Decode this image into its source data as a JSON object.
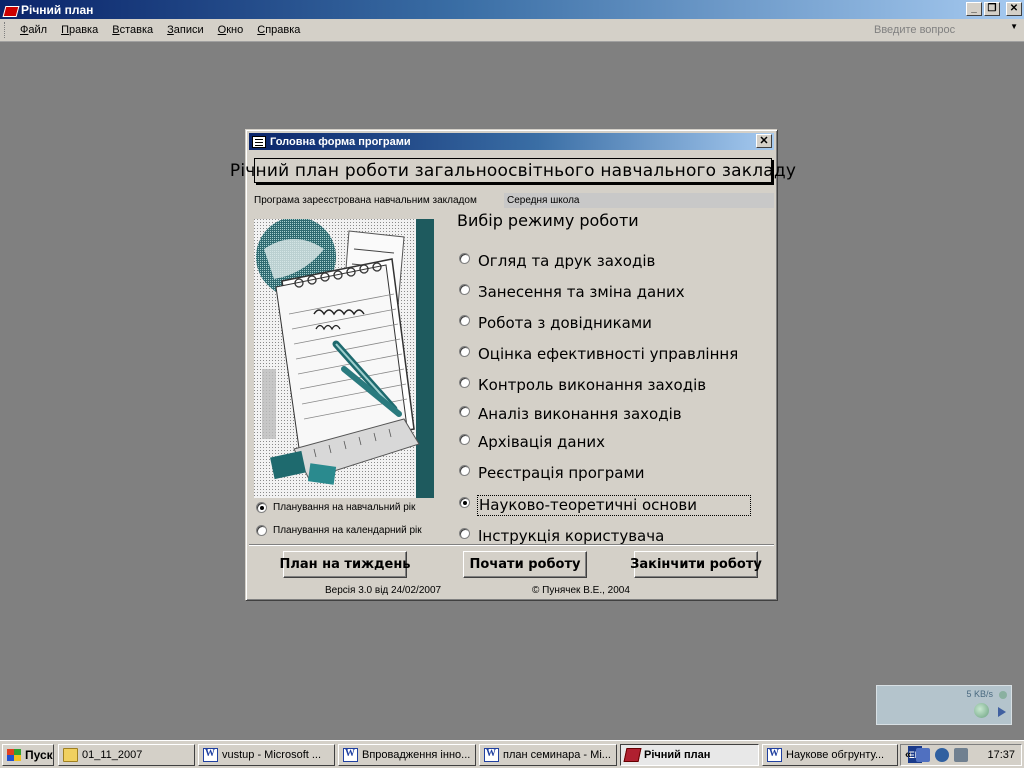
{
  "app": {
    "title": "Річний план",
    "menu": [
      "Файл",
      "Правка",
      "Вставка",
      "Записи",
      "Окно",
      "Справка"
    ],
    "help_placeholder": "Введите вопрос"
  },
  "form": {
    "title": "Головна форма програми",
    "heading": "Річний план роботи загальноосвітнього навчального закладу",
    "registered_label": "Програма зареєстрована навчальним закладом",
    "registered_value": "Середня школа",
    "mode_title": "Вибір режиму роботи",
    "modes": [
      {
        "label": "Огляд та друк заходів",
        "selected": false
      },
      {
        "label": "Занесення та зміна даних",
        "selected": false
      },
      {
        "label": "Робота з довідниками",
        "selected": false
      },
      {
        "label": "Оцінка ефективності управління",
        "selected": false
      },
      {
        "label": "Контроль виконання заходів",
        "selected": false
      },
      {
        "label": "Аналіз виконання заходів",
        "selected": false
      },
      {
        "label": "Архівація даних",
        "selected": false
      },
      {
        "label": "Реєстрація програми",
        "selected": false
      },
      {
        "label": "Науково-теоретичні основи",
        "selected": true
      },
      {
        "label": "Інструкція користувача",
        "selected": false
      }
    ],
    "planning": [
      {
        "label": "Планування на навчальний рік",
        "selected": true
      },
      {
        "label": "Планування на календарний рік",
        "selected": false
      }
    ],
    "buttons": {
      "week_plan": "План на тиждень",
      "start": "Почати  роботу",
      "finish": "Закінчити роботу"
    },
    "version": "Версія 3.0  від 24/02/2007",
    "copyright": "© Пунячек В.Е., 2004"
  },
  "net_widget": {
    "speed": "5 KB/s"
  },
  "taskbar": {
    "start": "Пуск",
    "tasks": [
      {
        "label": "01_11_2007",
        "icon": "folder-icon",
        "active": false
      },
      {
        "label": "vustup - Microsoft ...",
        "icon": "word-icon",
        "active": false
      },
      {
        "label": "Впровадження інно...",
        "icon": "word-icon",
        "active": false
      },
      {
        "label": "план семинара - Mi...",
        "icon": "word-icon",
        "active": false
      },
      {
        "label": "Річний план",
        "icon": "access-icon",
        "active": true
      },
      {
        "label": "Наукове обгрунту...",
        "icon": "word-icon",
        "active": false
      }
    ],
    "lang": "EN",
    "clock": "17:37"
  }
}
